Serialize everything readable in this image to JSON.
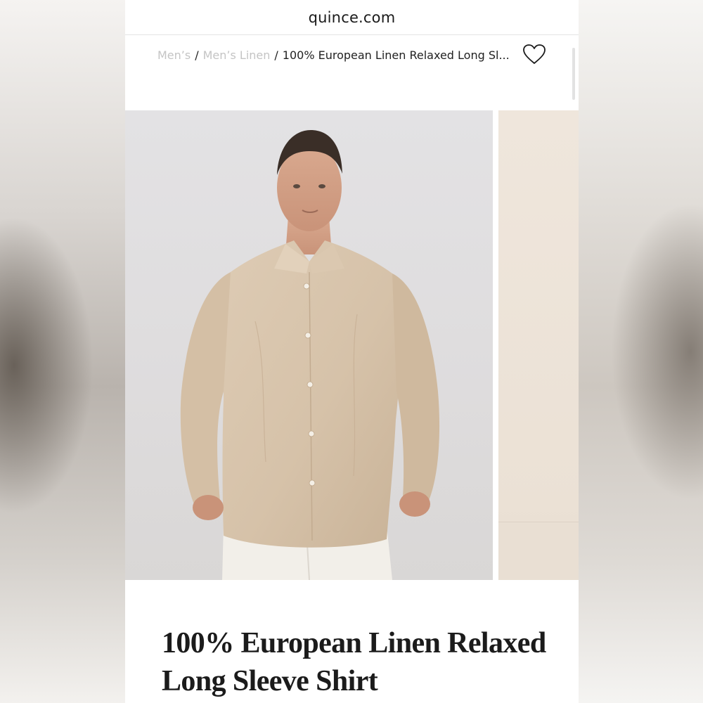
{
  "browser": {
    "url": "quince.com"
  },
  "breadcrumb": {
    "items": [
      {
        "label": "Men’s"
      },
      {
        "label": "Men’s Linen"
      }
    ],
    "separator": "/",
    "current": "100% European Linen Relaxed Long Sl..."
  },
  "wishlist": {
    "icon": "heart-outline-icon"
  },
  "gallery": {
    "images": [
      {
        "description_icon": "product-photo-model-front"
      },
      {
        "description_icon": "product-photo-next-partial"
      }
    ]
  },
  "product": {
    "title": "100% European Linen Relaxed Long Sleeve Shirt"
  },
  "colors": {
    "link_muted": "#c4c4c4",
    "text": "#1b1b1b",
    "shirt": "#d9c6ae"
  }
}
